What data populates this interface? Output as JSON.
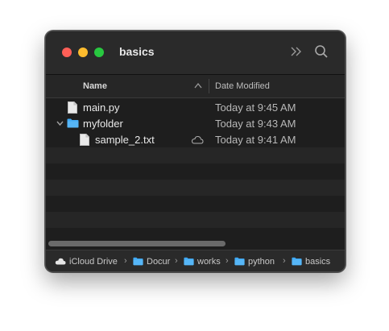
{
  "window": {
    "title": "basics",
    "colors": {
      "background": "#1e1e1e",
      "folder": "#3fa9f5",
      "close": "#ff5f57",
      "minimize": "#febc2e",
      "zoom": "#28c840"
    }
  },
  "toolbar": {
    "more_icon": "chevron-double-right-icon",
    "search_icon": "magnifier-icon"
  },
  "columns": {
    "name": "Name",
    "date_modified": "Date Modified"
  },
  "files": [
    {
      "name": "main.py",
      "date": "Today at 9:45 AM",
      "kind": "file",
      "indent": 0
    },
    {
      "name": "myfolder",
      "date": "Today at 9:43 AM",
      "kind": "folder",
      "indent": 0,
      "expanded": true
    },
    {
      "name": "sample_2.txt",
      "date": "Today at 9:41 AM",
      "kind": "file",
      "indent": 1,
      "cloud": true
    }
  ],
  "pathbar": {
    "items": [
      "iCloud Drive",
      "Docur",
      "works",
      "python",
      "basics"
    ],
    "separator": "›"
  }
}
